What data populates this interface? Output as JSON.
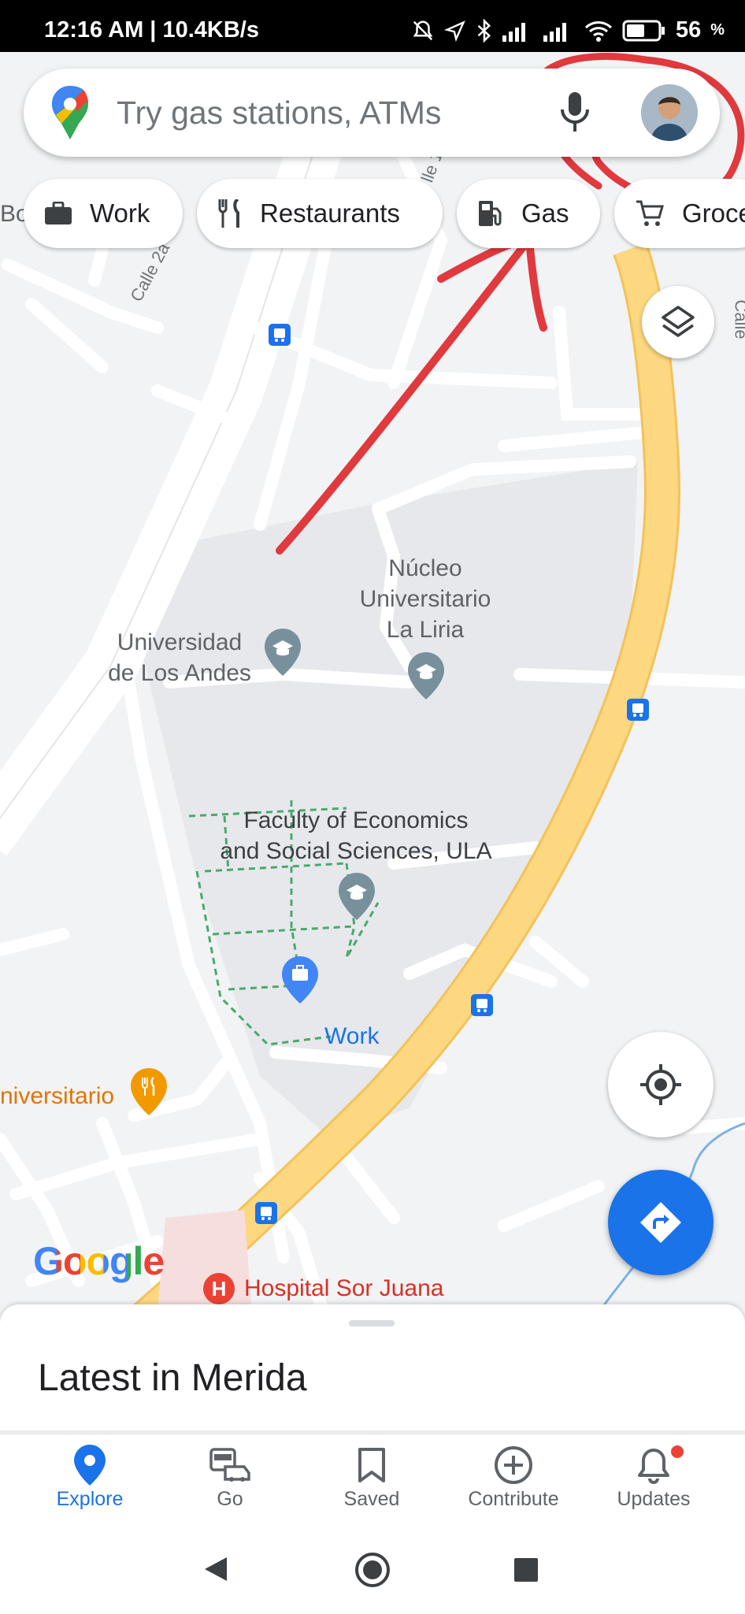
{
  "status_bar": {
    "time_speed": "12:16 AM | 10.4KB/s",
    "battery": "56",
    "battery_unit": "%"
  },
  "search": {
    "placeholder": "Try gas stations, ATMs"
  },
  "chips": [
    {
      "label": "Work",
      "icon": "briefcase-icon"
    },
    {
      "label": "Restaurants",
      "icon": "restaurant-icon"
    },
    {
      "label": "Gas",
      "icon": "gas-station-icon"
    },
    {
      "label": "Groce",
      "icon": "cart-icon"
    }
  ],
  "map": {
    "streets": [
      "Calle 2a",
      "lle 1",
      "Calle"
    ],
    "places": {
      "nucleo": "Núcleo\nUniversitario\nLa Liria",
      "ula": "Universidad\nde Los Andes",
      "faculty": "Faculty of Economics\nand Social Sciences, ULA",
      "work": "Work",
      "restaurant": "niversitario",
      "hospital": "Hospital Sor Juana",
      "left_edge": "Bo"
    },
    "logo": "Google"
  },
  "sheet": {
    "title": "Latest in Merida"
  },
  "bottom_nav": [
    {
      "label": "Explore",
      "icon": "explore-pin-icon",
      "active": true
    },
    {
      "label": "Go",
      "icon": "commute-icon",
      "active": false
    },
    {
      "label": "Saved",
      "icon": "bookmark-icon",
      "active": false
    },
    {
      "label": "Contribute",
      "icon": "add-circle-icon",
      "active": false
    },
    {
      "label": "Updates",
      "icon": "bell-icon",
      "active": false,
      "badge": true
    }
  ],
  "colors": {
    "accent": "#1a73e8",
    "highway": "#fdd881",
    "annotation": "#e0393e"
  }
}
